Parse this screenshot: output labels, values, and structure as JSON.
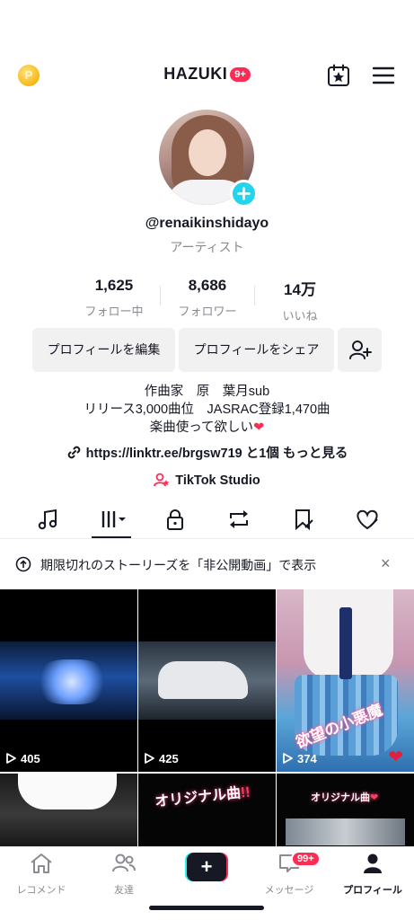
{
  "header": {
    "title": "HAZUKI",
    "badge": "9+",
    "coin_letter": "P"
  },
  "profile": {
    "username": "@renaikinshidayo",
    "role": "アーティスト"
  },
  "stats": [
    {
      "value": "1,625",
      "label": "フォロー中"
    },
    {
      "value": "8,686",
      "label": "フォロワー"
    },
    {
      "value": "14万",
      "label": "いいね"
    }
  ],
  "actions": {
    "edit_label": "プロフィールを編集",
    "share_label": "プロフィールをシェア"
  },
  "bio": {
    "line1": "作曲家　原　葉月sub",
    "line2": "リリース3,000曲位　JASRAC登録1,470曲",
    "line3": "楽曲使って欲しい",
    "heart": "❤"
  },
  "link": {
    "url": "https://linktr.ee/brgsw719",
    "suffix": "と1個 もっと見る"
  },
  "studio_label": "TikTok Studio",
  "tabs": [
    "music-icon",
    "videos-grid-icon",
    "lock-icon",
    "repost-icon",
    "favorites-icon",
    "liked-icon"
  ],
  "notice": {
    "text": "期限切れのストーリーズを「非公開動画」で表示",
    "close": "×"
  },
  "videos": [
    {
      "views": "405"
    },
    {
      "views": "425"
    },
    {
      "views": "374",
      "caption": "欲望の小悪魔"
    },
    {
      "views": ""
    },
    {
      "caption_main": "オリジナル曲",
      "caption_ex": "!!"
    },
    {
      "caption_main": "オリジナル曲",
      "caption_heart": "❤"
    }
  ],
  "bottom_nav": {
    "home": "レコメンド",
    "friends": "友達",
    "create": "+",
    "inbox": "メッセージ",
    "inbox_badge": "99+",
    "profile": "プロフィール"
  },
  "colors": {
    "accent": "#fe2c55",
    "cyan": "#25f4ee",
    "text": "#161823",
    "muted": "#8a8b91"
  }
}
